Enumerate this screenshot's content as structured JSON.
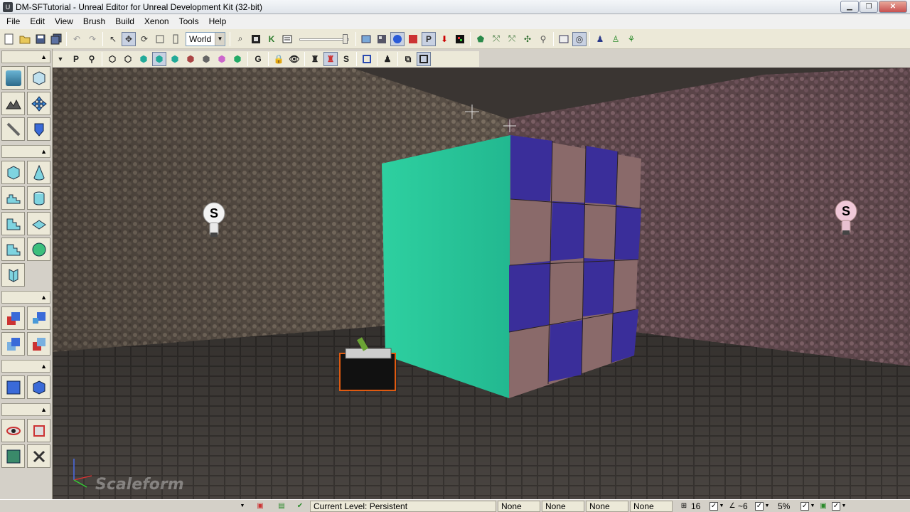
{
  "window": {
    "title": "DM-SFTutorial - Unreal Editor for Unreal Development Kit (32-bit)",
    "app_icon": "U",
    "minimize": "▁",
    "maximize": "❐",
    "close": "✕"
  },
  "menu": {
    "items": [
      "File",
      "Edit",
      "View",
      "Brush",
      "Build",
      "Xenon",
      "Tools",
      "Help"
    ]
  },
  "toolbar": {
    "coordinate_system": "World",
    "coordinate_arrow": "▼"
  },
  "toolbar2": {
    "dropdown_arrow": "▼",
    "labels": [
      "P",
      "G",
      "S"
    ]
  },
  "left_panel": {
    "collapse_glyph": "▲"
  },
  "viewport": {
    "light_label_left": "S",
    "light_label_right": "S",
    "watermark": "Scaleform"
  },
  "statusbar": {
    "current_level": "Current Level:  Persistent",
    "fields": [
      "None",
      "None",
      "None",
      "None"
    ],
    "grid_size": "16",
    "rotation_snap": "~6",
    "scale_snap": "5%"
  }
}
